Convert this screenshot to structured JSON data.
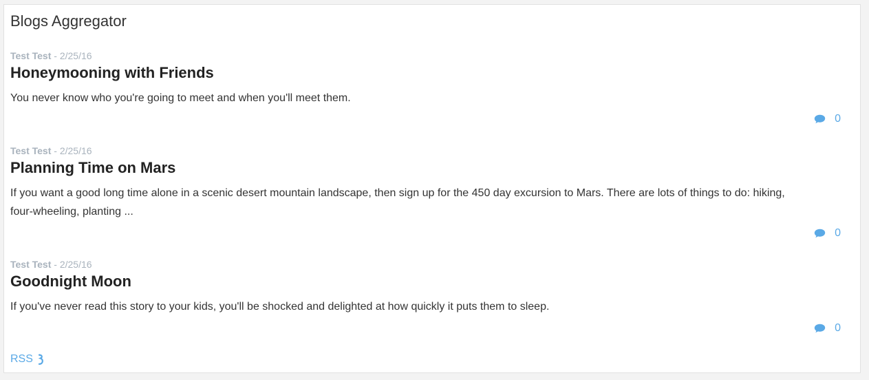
{
  "page": {
    "title": "Blogs Aggregator"
  },
  "posts": [
    {
      "author": "Test Test",
      "date": "- 2/25/16",
      "title": "Honeymooning with Friends",
      "excerpt": "You never know who you're going to meet and when you'll meet them.",
      "comment_count": "0"
    },
    {
      "author": "Test Test",
      "date": "- 2/25/16",
      "title": "Planning Time on Mars",
      "excerpt": "If you want a good long time alone in a scenic desert mountain landscape, then sign up for the 450 day excursion to Mars. There are lots of things to do: hiking, four-wheeling, planting ...",
      "comment_count": "0"
    },
    {
      "author": "Test Test",
      "date": "- 2/25/16",
      "title": "Goodnight Moon",
      "excerpt": "If you've never read this story to your kids, you'll be shocked and delighted at how quickly it puts them to sleep.",
      "comment_count": "0"
    }
  ],
  "footer": {
    "rss_label": "RSS"
  },
  "icons": {
    "comment": "comment-icon",
    "rss": "rss-icon"
  },
  "colors": {
    "accent": "#5aa9e6",
    "meta": "#a9b3bd",
    "background": "#f3f3f3",
    "panel": "#ffffff"
  }
}
